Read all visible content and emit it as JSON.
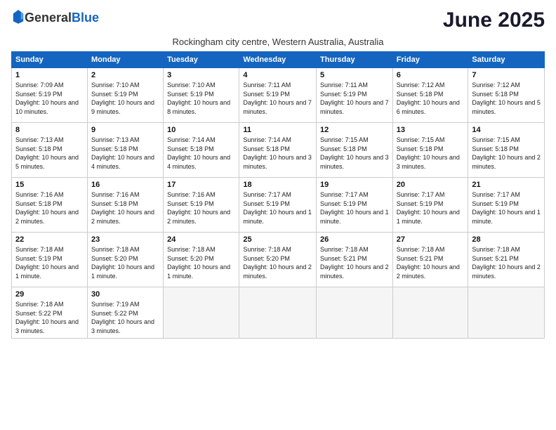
{
  "header": {
    "logo_general": "General",
    "logo_blue": "Blue",
    "month_title": "June 2025",
    "subtitle": "Rockingham city centre, Western Australia, Australia"
  },
  "columns": [
    "Sunday",
    "Monday",
    "Tuesday",
    "Wednesday",
    "Thursday",
    "Friday",
    "Saturday"
  ],
  "weeks": [
    [
      {
        "day": "1",
        "info": "Sunrise: 7:09 AM\nSunset: 5:19 PM\nDaylight: 10 hours and 10 minutes."
      },
      {
        "day": "2",
        "info": "Sunrise: 7:10 AM\nSunset: 5:19 PM\nDaylight: 10 hours and 9 minutes."
      },
      {
        "day": "3",
        "info": "Sunrise: 7:10 AM\nSunset: 5:19 PM\nDaylight: 10 hours and 8 minutes."
      },
      {
        "day": "4",
        "info": "Sunrise: 7:11 AM\nSunset: 5:19 PM\nDaylight: 10 hours and 7 minutes."
      },
      {
        "day": "5",
        "info": "Sunrise: 7:11 AM\nSunset: 5:19 PM\nDaylight: 10 hours and 7 minutes."
      },
      {
        "day": "6",
        "info": "Sunrise: 7:12 AM\nSunset: 5:18 PM\nDaylight: 10 hours and 6 minutes."
      },
      {
        "day": "7",
        "info": "Sunrise: 7:12 AM\nSunset: 5:18 PM\nDaylight: 10 hours and 5 minutes."
      }
    ],
    [
      {
        "day": "8",
        "info": "Sunrise: 7:13 AM\nSunset: 5:18 PM\nDaylight: 10 hours and 5 minutes."
      },
      {
        "day": "9",
        "info": "Sunrise: 7:13 AM\nSunset: 5:18 PM\nDaylight: 10 hours and 4 minutes."
      },
      {
        "day": "10",
        "info": "Sunrise: 7:14 AM\nSunset: 5:18 PM\nDaylight: 10 hours and 4 minutes."
      },
      {
        "day": "11",
        "info": "Sunrise: 7:14 AM\nSunset: 5:18 PM\nDaylight: 10 hours and 3 minutes."
      },
      {
        "day": "12",
        "info": "Sunrise: 7:15 AM\nSunset: 5:18 PM\nDaylight: 10 hours and 3 minutes."
      },
      {
        "day": "13",
        "info": "Sunrise: 7:15 AM\nSunset: 5:18 PM\nDaylight: 10 hours and 3 minutes."
      },
      {
        "day": "14",
        "info": "Sunrise: 7:15 AM\nSunset: 5:18 PM\nDaylight: 10 hours and 2 minutes."
      }
    ],
    [
      {
        "day": "15",
        "info": "Sunrise: 7:16 AM\nSunset: 5:18 PM\nDaylight: 10 hours and 2 minutes."
      },
      {
        "day": "16",
        "info": "Sunrise: 7:16 AM\nSunset: 5:18 PM\nDaylight: 10 hours and 2 minutes."
      },
      {
        "day": "17",
        "info": "Sunrise: 7:16 AM\nSunset: 5:19 PM\nDaylight: 10 hours and 2 minutes."
      },
      {
        "day": "18",
        "info": "Sunrise: 7:17 AM\nSunset: 5:19 PM\nDaylight: 10 hours and 1 minute."
      },
      {
        "day": "19",
        "info": "Sunrise: 7:17 AM\nSunset: 5:19 PM\nDaylight: 10 hours and 1 minute."
      },
      {
        "day": "20",
        "info": "Sunrise: 7:17 AM\nSunset: 5:19 PM\nDaylight: 10 hours and 1 minute."
      },
      {
        "day": "21",
        "info": "Sunrise: 7:17 AM\nSunset: 5:19 PM\nDaylight: 10 hours and 1 minute."
      }
    ],
    [
      {
        "day": "22",
        "info": "Sunrise: 7:18 AM\nSunset: 5:19 PM\nDaylight: 10 hours and 1 minute."
      },
      {
        "day": "23",
        "info": "Sunrise: 7:18 AM\nSunset: 5:20 PM\nDaylight: 10 hours and 1 minute."
      },
      {
        "day": "24",
        "info": "Sunrise: 7:18 AM\nSunset: 5:20 PM\nDaylight: 10 hours and 1 minute."
      },
      {
        "day": "25",
        "info": "Sunrise: 7:18 AM\nSunset: 5:20 PM\nDaylight: 10 hours and 2 minutes."
      },
      {
        "day": "26",
        "info": "Sunrise: 7:18 AM\nSunset: 5:21 PM\nDaylight: 10 hours and 2 minutes."
      },
      {
        "day": "27",
        "info": "Sunrise: 7:18 AM\nSunset: 5:21 PM\nDaylight: 10 hours and 2 minutes."
      },
      {
        "day": "28",
        "info": "Sunrise: 7:18 AM\nSunset: 5:21 PM\nDaylight: 10 hours and 2 minutes."
      }
    ],
    [
      {
        "day": "29",
        "info": "Sunrise: 7:18 AM\nSunset: 5:22 PM\nDaylight: 10 hours and 3 minutes."
      },
      {
        "day": "30",
        "info": "Sunrise: 7:19 AM\nSunset: 5:22 PM\nDaylight: 10 hours and 3 minutes."
      },
      {
        "day": "",
        "info": ""
      },
      {
        "day": "",
        "info": ""
      },
      {
        "day": "",
        "info": ""
      },
      {
        "day": "",
        "info": ""
      },
      {
        "day": "",
        "info": ""
      }
    ]
  ]
}
